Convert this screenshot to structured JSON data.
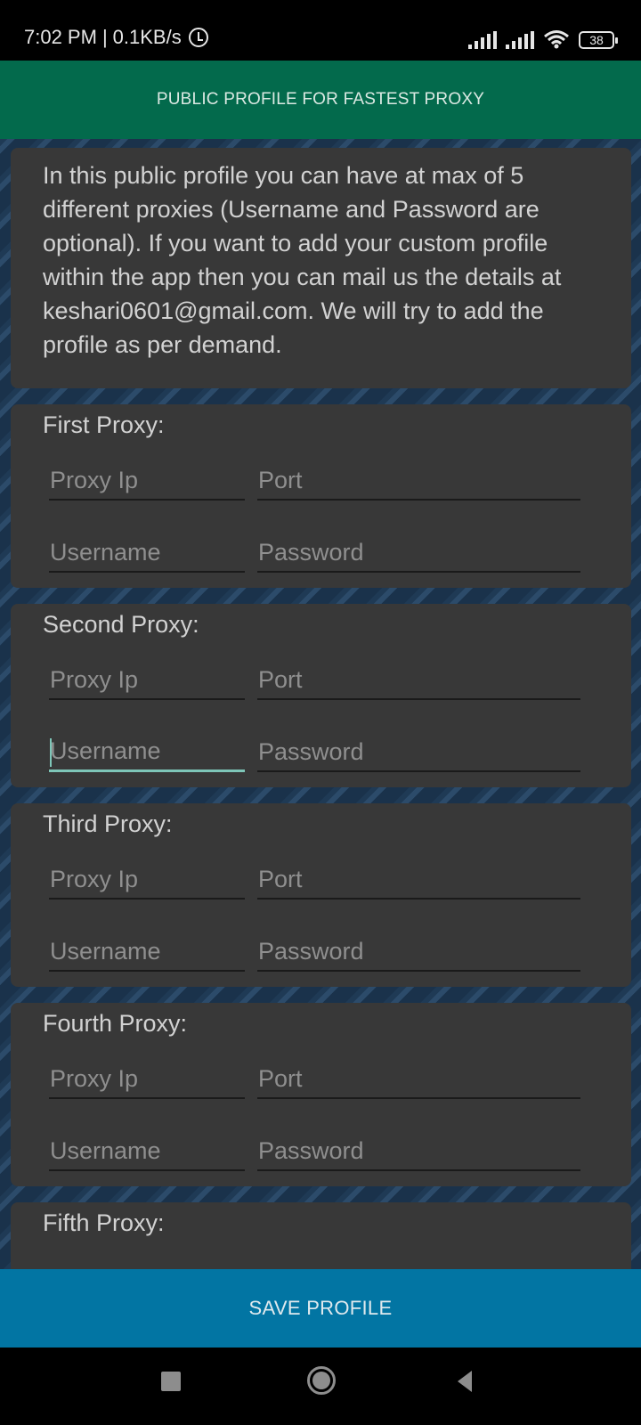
{
  "status_bar": {
    "time": "7:02 PM",
    "separator": "|",
    "network_speed": "0.1KB/s",
    "icons": [
      "alarm-icon",
      "signal-icon",
      "signal-icon",
      "wifi-icon",
      "battery-icon"
    ],
    "battery_level": "38"
  },
  "app_bar": {
    "title": "PUBLIC PROFILE FOR FASTEST PROXY",
    "color": "#036a4c"
  },
  "intro": {
    "text": "In this public profile you can have at max of 5 different proxies (Username and Password are optional). If you want to add your custom profile within the app then you can mail us the details at keshari0601@gmail.com. We will try to add the profile as per demand."
  },
  "proxies": [
    {
      "title": "First Proxy:",
      "ip_placeholder": "Proxy Ip",
      "port_placeholder": "Port",
      "username_placeholder": "Username",
      "password_placeholder": "Password",
      "ip": "",
      "port": "",
      "username": "",
      "password": ""
    },
    {
      "title": "Second Proxy:",
      "ip_placeholder": "Proxy Ip",
      "port_placeholder": "Port",
      "username_placeholder": "Username",
      "password_placeholder": "Password",
      "ip": "",
      "port": "",
      "username": "",
      "password": "",
      "focused_field": "username"
    },
    {
      "title": "Third Proxy:",
      "ip_placeholder": "Proxy Ip",
      "port_placeholder": "Port",
      "username_placeholder": "Username",
      "password_placeholder": "Password",
      "ip": "",
      "port": "",
      "username": "",
      "password": ""
    },
    {
      "title": "Fourth Proxy:",
      "ip_placeholder": "Proxy Ip",
      "port_placeholder": "Port",
      "username_placeholder": "Username",
      "password_placeholder": "Password",
      "ip": "",
      "port": "",
      "username": "",
      "password": ""
    },
    {
      "title": "Fifth Proxy:"
    }
  ],
  "save_button": {
    "label": "SAVE PROFILE",
    "color": "#0275a3"
  },
  "nav_bar": {
    "icons": [
      "recent-apps-icon",
      "home-icon",
      "back-icon"
    ]
  },
  "accent_color": "#7ec6b8"
}
